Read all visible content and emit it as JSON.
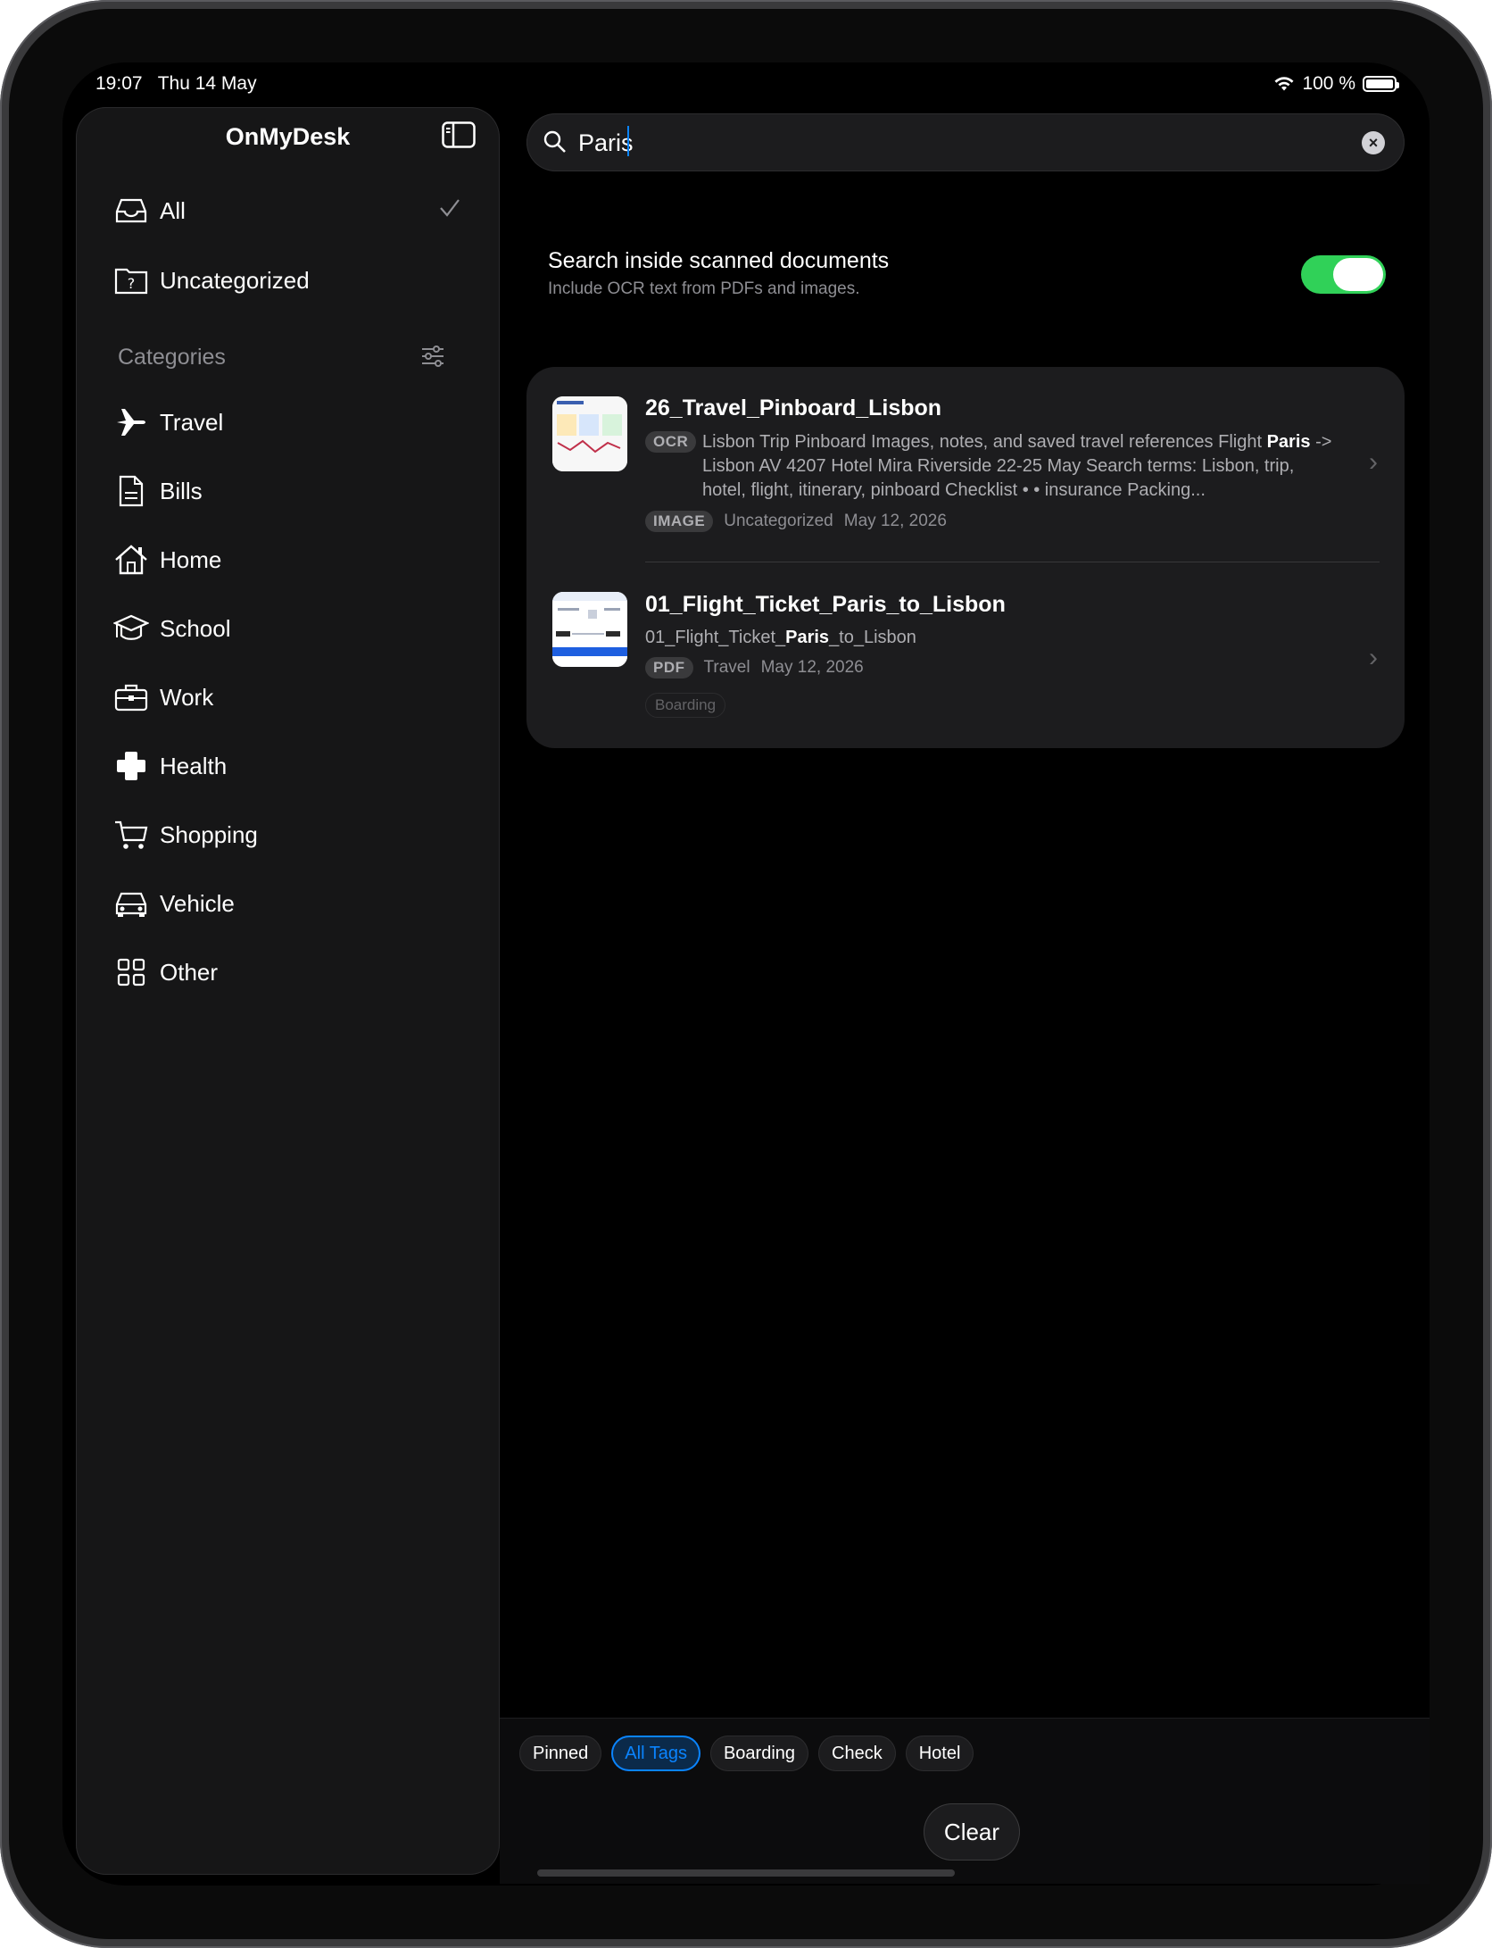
{
  "status_bar": {
    "time": "19:07",
    "date": "Thu 14 May",
    "battery": "100 %"
  },
  "sidebar": {
    "title": "OnMyDesk",
    "all_label": "All",
    "uncategorized_label": "Uncategorized",
    "categories_header": "Categories",
    "items": [
      {
        "label": "Travel",
        "icon": "airplane-icon"
      },
      {
        "label": "Bills",
        "icon": "document-icon"
      },
      {
        "label": "Home",
        "icon": "house-icon"
      },
      {
        "label": "School",
        "icon": "graduation-cap-icon"
      },
      {
        "label": "Work",
        "icon": "briefcase-icon"
      },
      {
        "label": "Health",
        "icon": "cross-icon"
      },
      {
        "label": "Shopping",
        "icon": "cart-icon"
      },
      {
        "label": "Vehicle",
        "icon": "car-icon"
      },
      {
        "label": "Other",
        "icon": "grid-icon"
      }
    ]
  },
  "search": {
    "value": "Paris"
  },
  "ocr_option": {
    "title": "Search inside scanned documents",
    "subtitle": "Include OCR text from PDFs and images.",
    "enabled": true
  },
  "results": [
    {
      "title": "26_Travel_Pinboard_Lisbon",
      "snippet_badge": "OCR",
      "snippet_line1_pre": "Lisbon Trip Pinboard Images, notes, and saved travel references Flight ",
      "snippet_line1_bold": "Paris",
      "snippet_line1_post": " ->",
      "snippet_line2": "Lisbon AV 4207 Hotel Mira Riverside 22-25 May Search terms: Lisbon, trip,",
      "snippet_line3": "hotel, flight, itinerary, pinboard Checklist • • insurance Packing...",
      "type": "IMAGE",
      "category": "Uncategorized",
      "date": "May 12, 2026"
    },
    {
      "title": "01_Flight_Ticket_Paris_to_Lisbon",
      "snippet_pre": "01_Flight_Ticket_",
      "snippet_bold": "Paris",
      "snippet_post": "_to_Lisbon",
      "type": "PDF",
      "category": "Travel",
      "date": "May 12, 2026",
      "tag": "Boarding"
    }
  ],
  "tag_chips": [
    "Pinned",
    "All Tags",
    "Boarding",
    "Check",
    "Hotel"
  ],
  "active_chip": "All Tags",
  "clear_label": "Clear",
  "colors": {
    "accent": "#0a84ff",
    "toggle_on": "#30d158",
    "background": "#000000",
    "surface": "#1c1c1e"
  }
}
